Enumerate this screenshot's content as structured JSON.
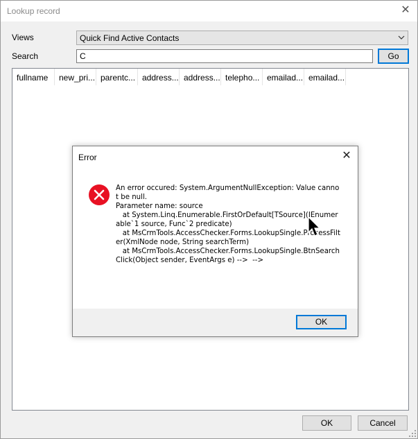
{
  "window": {
    "title": "Lookup record",
    "close_icon": "close-icon"
  },
  "filters": {
    "views_label": "Views",
    "views_value": "Quick Find Active Contacts",
    "search_label": "Search",
    "search_value": "C",
    "go_label": "Go"
  },
  "grid": {
    "columns": [
      "fullname",
      "new_pri...",
      "parentc...",
      "address...",
      "address...",
      "telepho...",
      "emailad...",
      "emailad..."
    ]
  },
  "error_dialog": {
    "title": "Error",
    "message": "An error occured: System.ArgumentNullException: Value cannot be null.\nParameter name: source\n   at System.Linq.Enumerable.FirstOrDefault[TSource](IEnumerable`1 source, Func`2 predicate)\n   at MsCrmTools.AccessChecker.Forms.LookupSingle.ProcessFilter(XmlNode node, String searchTerm)\n   at MsCrmTools.AccessChecker.Forms.LookupSingle.BtnSearchClick(Object sender, EventArgs e) -->  -->",
    "ok_label": "OK",
    "icon": "error-icon",
    "accent": "#e81123"
  },
  "footer": {
    "ok_label": "OK",
    "cancel_label": "Cancel"
  }
}
